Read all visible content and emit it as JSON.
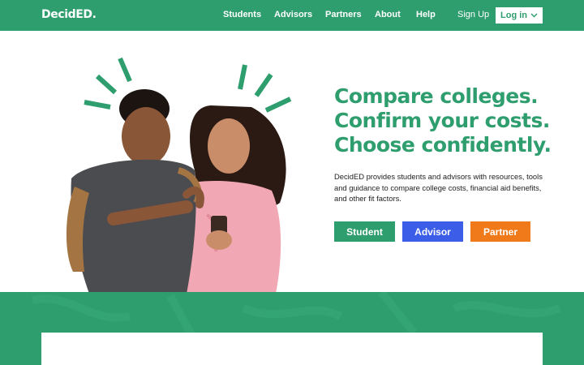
{
  "nav": {
    "logo": "DecidED.",
    "links": [
      "Students",
      "Advisors",
      "Partners",
      "About",
      "Help"
    ],
    "signup": "Sign Up",
    "login": "Log in"
  },
  "hero": {
    "headline": [
      "Compare colleges.",
      "Confirm your costs.",
      "Choose confidently."
    ],
    "description": "DecidED provides students and advisors with resources, tools and guidance to compare college costs, financial aid benefits, and other fit factors.",
    "buttons": {
      "student": "Student",
      "advisor": "Advisor",
      "partner": "Partner"
    }
  },
  "colors": {
    "brand_green": "#2f9e6e",
    "advisor_blue": "#3b5de7",
    "partner_orange": "#f07a1a"
  },
  "icons": [
    "chevron-down-icon"
  ]
}
